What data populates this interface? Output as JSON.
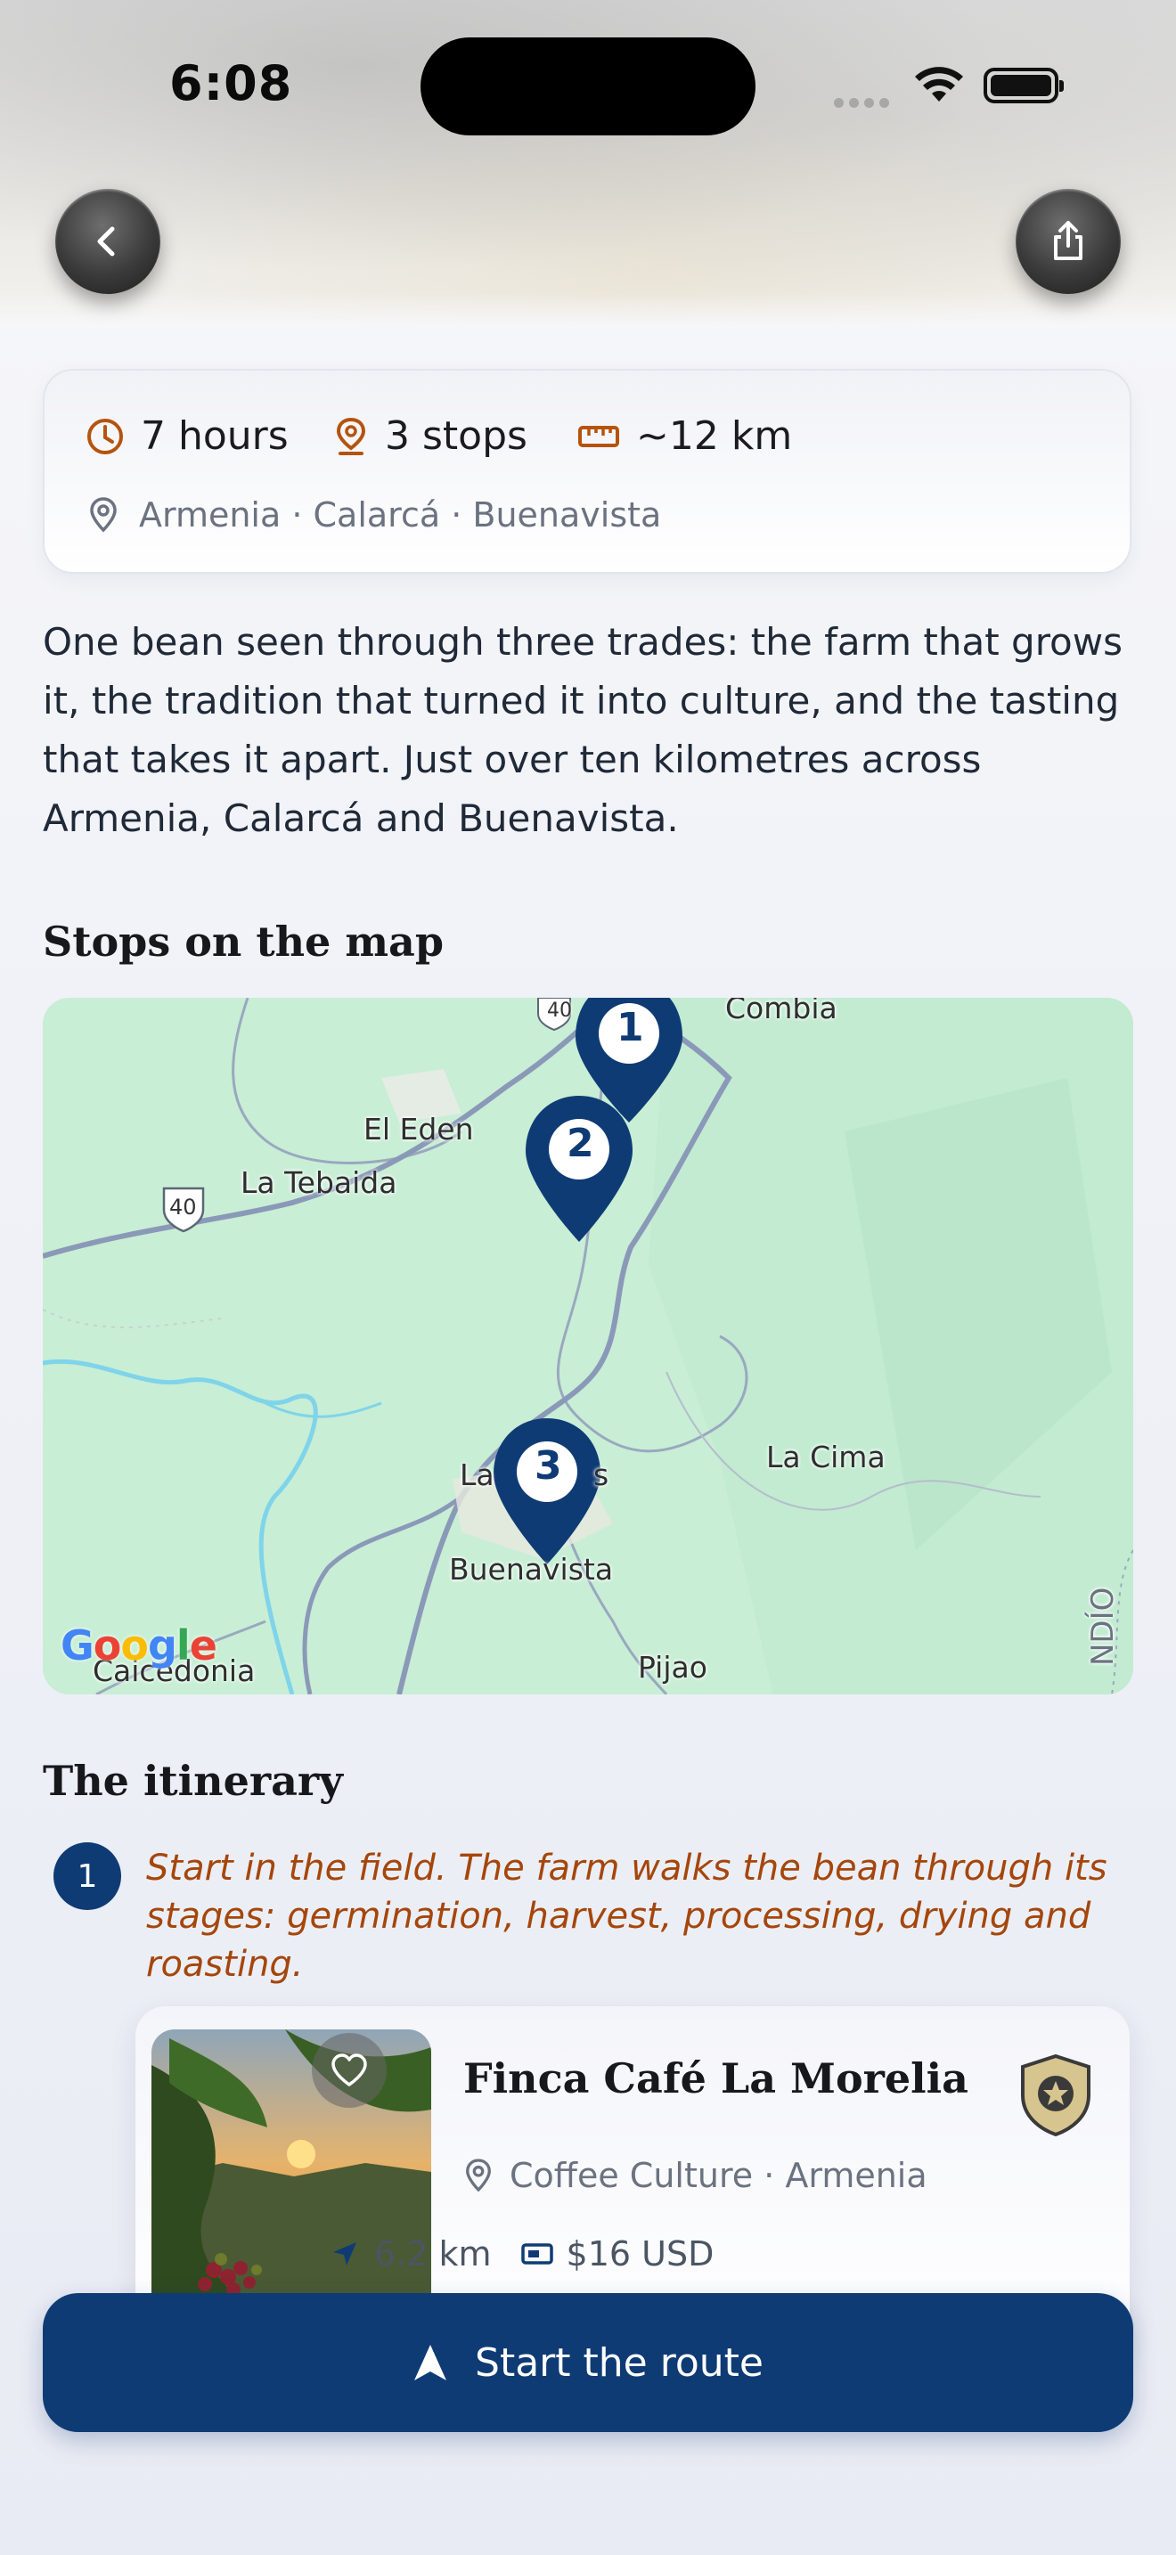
{
  "status_bar": {
    "time": "6:08"
  },
  "header": {
    "back_icon": "chevron-left-icon",
    "share_icon": "share-icon"
  },
  "summary": {
    "duration": "7 hours",
    "stops": "3 stops",
    "distance": "~12 km",
    "places": "Armenia · Calarcá · Buenavista",
    "accent_color": "#b5530f"
  },
  "intro": "One bean seen through three trades: the farm that grows it, the tradition that turned it into culture, and the tasting that takes it apart. Just over ten kilometres across Armenia, Calarcá and Buenavista.",
  "map_section": {
    "title": "Stops on the map",
    "labels": {
      "colombia": "Combia",
      "el_eden": "El Eden",
      "la_tebaida": "La Tebaida",
      "route_40a": "40",
      "route_40b": "40",
      "la_cima": "La Cima",
      "las": "La",
      "las_end": "s",
      "buenavista": "Buenavista",
      "caicedonia": "Caicedonia",
      "pijao": "Pijao",
      "quindio": "NDÍO",
      "google": "Google"
    },
    "pins": [
      "1",
      "2",
      "3"
    ],
    "pin_color": "#0f3b75"
  },
  "itinerary": {
    "title": "The itinerary",
    "steps": [
      {
        "number": "1",
        "description": "Start in the field. The farm walks the bean through its stages: germination, harvest, processing, drying and roasting.",
        "place": {
          "name": "Finca Café La Morelia",
          "category": "Coffee Culture · Armenia",
          "distance": "6.2 km",
          "price": "$16 USD"
        }
      }
    ]
  },
  "cta": {
    "label": "Start the route",
    "color": "#0f3b75"
  }
}
